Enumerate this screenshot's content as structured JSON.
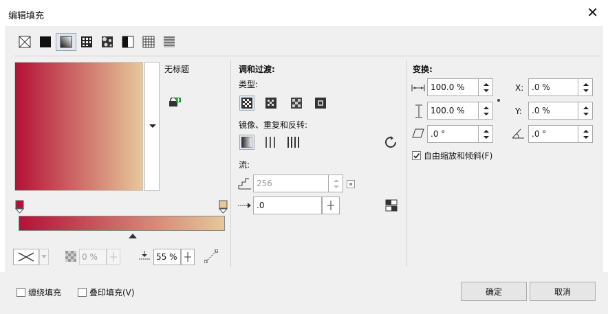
{
  "window": {
    "title": "编辑填充",
    "close_glyph": "✕"
  },
  "toolbar": {
    "buttons": [
      {
        "name": "no-fill-icon"
      },
      {
        "name": "uniform-fill-icon"
      },
      {
        "name": "fountain-fill-icon"
      },
      {
        "name": "vector-pattern-fill-icon"
      },
      {
        "name": "bitmap-pattern-fill-icon"
      },
      {
        "name": "two-color-pattern-fill-icon"
      },
      {
        "name": "texture-fill-icon"
      },
      {
        "name": "postscript-fill-icon"
      }
    ],
    "active_index": 2
  },
  "preset": {
    "name": "无标题"
  },
  "gradient": {
    "start_color": "#b51137",
    "end_color": "#e6c89a"
  },
  "bottom_controls": {
    "opacity": "0 %",
    "acceleration": "55 %"
  },
  "blend": {
    "heading": "调和过渡:",
    "type_label": "类型:",
    "mirror_label": "镜像、重复和反转:",
    "flow_label": "流:",
    "steps": "256",
    "acceleration": ".0"
  },
  "transform": {
    "heading": "变换:",
    "width": "100.0 %",
    "height": "100.0 %",
    "skew": ".0 °",
    "x_label": "X:",
    "x": ".0 %",
    "y_label": "Y:",
    "y": ".0 %",
    "rotate": ".0 °",
    "free_scale_label": "自由缩放和倾斜(F)",
    "free_scale_checked": true
  },
  "footer": {
    "wrap_fill": "缠绕填充",
    "overprint_fill": "叠印填充(V)",
    "ok": "确定",
    "cancel": "取消"
  }
}
